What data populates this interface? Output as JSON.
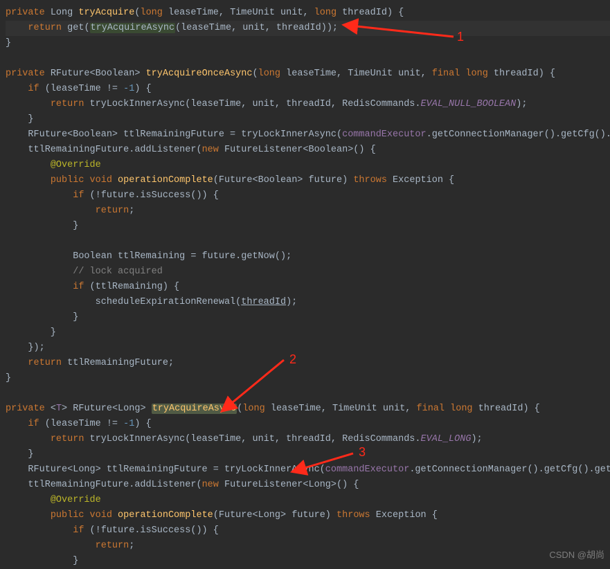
{
  "code": {
    "l1": {
      "kw_private": "private",
      "type_Long": "Long",
      "meth": "tryAcquire",
      "kw_long": "long",
      "p_lease": "leaseTime",
      "type_TU": "TimeUnit",
      "p_unit": "unit",
      "kw_long2": "long",
      "p_thread": "threadId"
    },
    "l2": {
      "kw_return": "return",
      "get": "get",
      "hl": "tryAcquireAsync",
      "args": "(leaseTime, unit, threadId));"
    },
    "l3_brace": "}",
    "l5": {
      "kw_private": "private",
      "rtype": "RFuture<Boolean>",
      "meth": "tryAcquireOnceAsync",
      "kw_long": "long",
      "p_lease": "leaseTime",
      "type_TU": "TimeUnit",
      "p_unit": "unit",
      "kw_final": "final",
      "kw_long2": "long",
      "p_thread": "threadId"
    },
    "l6": {
      "kw_if": "if",
      "cond_a": "(leaseTime != ",
      "neg1": "-1",
      "cond_b": ") {"
    },
    "l7": {
      "kw_return": "return",
      "call": "tryLockInnerAsync(leaseTime, unit, threadId, RedisCommands.",
      "cst": "EVAL_NULL_BOOLEAN",
      "end": ");"
    },
    "l8_brace": "    }",
    "l9": {
      "part_a": "RFuture<Boolean> ttlRemainingFuture = tryLockInnerAsync(",
      "field": "commandExecutor",
      "part_b": ".getConnectionManager().getCfg().g"
    },
    "l10": {
      "pre": "ttlRemainingFuture.addListener(",
      "kw_new": "new",
      "post": " FutureListener<Boolean>() {"
    },
    "l11_override": "@Override",
    "l12": {
      "kw_public": "public",
      "kw_void": "void",
      "meth": "operationComplete",
      "args": "(Future<Boolean> future)",
      "kw_throws": "throws",
      "exc": " Exception {"
    },
    "l13": {
      "kw_if": "if",
      "cond": " (!future.isSuccess()) {"
    },
    "l14_return": "return",
    "l14_semi": ";",
    "l15_brace": "            }",
    "l17": {
      "decl": "Boolean ttlRemaining = future.getNow();"
    },
    "l18_cmt": "// lock acquired",
    "l19": {
      "kw_if": "if",
      "cond": " (ttlRemaining) {"
    },
    "l20": {
      "call": "scheduleExpirationRenewal(",
      "arg": "threadId",
      "end": ");"
    },
    "l21_brace": "            }",
    "l22_brace": "        }",
    "l23_close": "    });",
    "l24": {
      "kw_return": "return",
      "expr": " ttlRemainingFuture;"
    },
    "l25_brace": "}",
    "l27": {
      "kw_private": "private",
      "gen": "<",
      "T": "T",
      "gen2": "> RFuture<Long>",
      "meth": "tryAcquireAsync",
      "kw_long": "long",
      "p_lease": "leaseTime",
      "type_TU": "TimeUnit",
      "p_unit": "unit",
      "kw_final": "final",
      "kw_long2": "long",
      "p_thread": "threadId"
    },
    "l28": {
      "kw_if": "if",
      "cond_a": "(leaseTime != ",
      "neg1": "-1",
      "cond_b": ") {"
    },
    "l29": {
      "kw_return": "return",
      "call": "tryLockInnerAsync(leaseTime, unit, threadId, RedisCommands.",
      "cst": "EVAL_LONG",
      "end": ");"
    },
    "l30_brace": "    }",
    "l31": {
      "part_a": "RFuture<Long> ttlRemainingFuture = tryLockInnerAsync(",
      "field": "commandExecutor",
      "part_b": ".getConnectionManager().getCfg().getL"
    },
    "l32": {
      "pre": "ttlRemainingFuture.addListener(",
      "kw_new": "new",
      "post": " FutureListener<Long>() {"
    },
    "l33_override": "@Override",
    "l34": {
      "kw_public": "public",
      "kw_void": "void",
      "meth": "operationComplete",
      "args": "(Future<Long> future)",
      "kw_throws": "throws",
      "exc": " Exception {"
    },
    "l35": {
      "kw_if": "if",
      "cond": " (!future.isSuccess()) {"
    },
    "l36_return": "return",
    "l36_semi": ";",
    "l37_brace": "            }"
  },
  "labels": {
    "n1": "1",
    "n2": "2",
    "n3": "3"
  },
  "watermark": "CSDN @胡尚"
}
